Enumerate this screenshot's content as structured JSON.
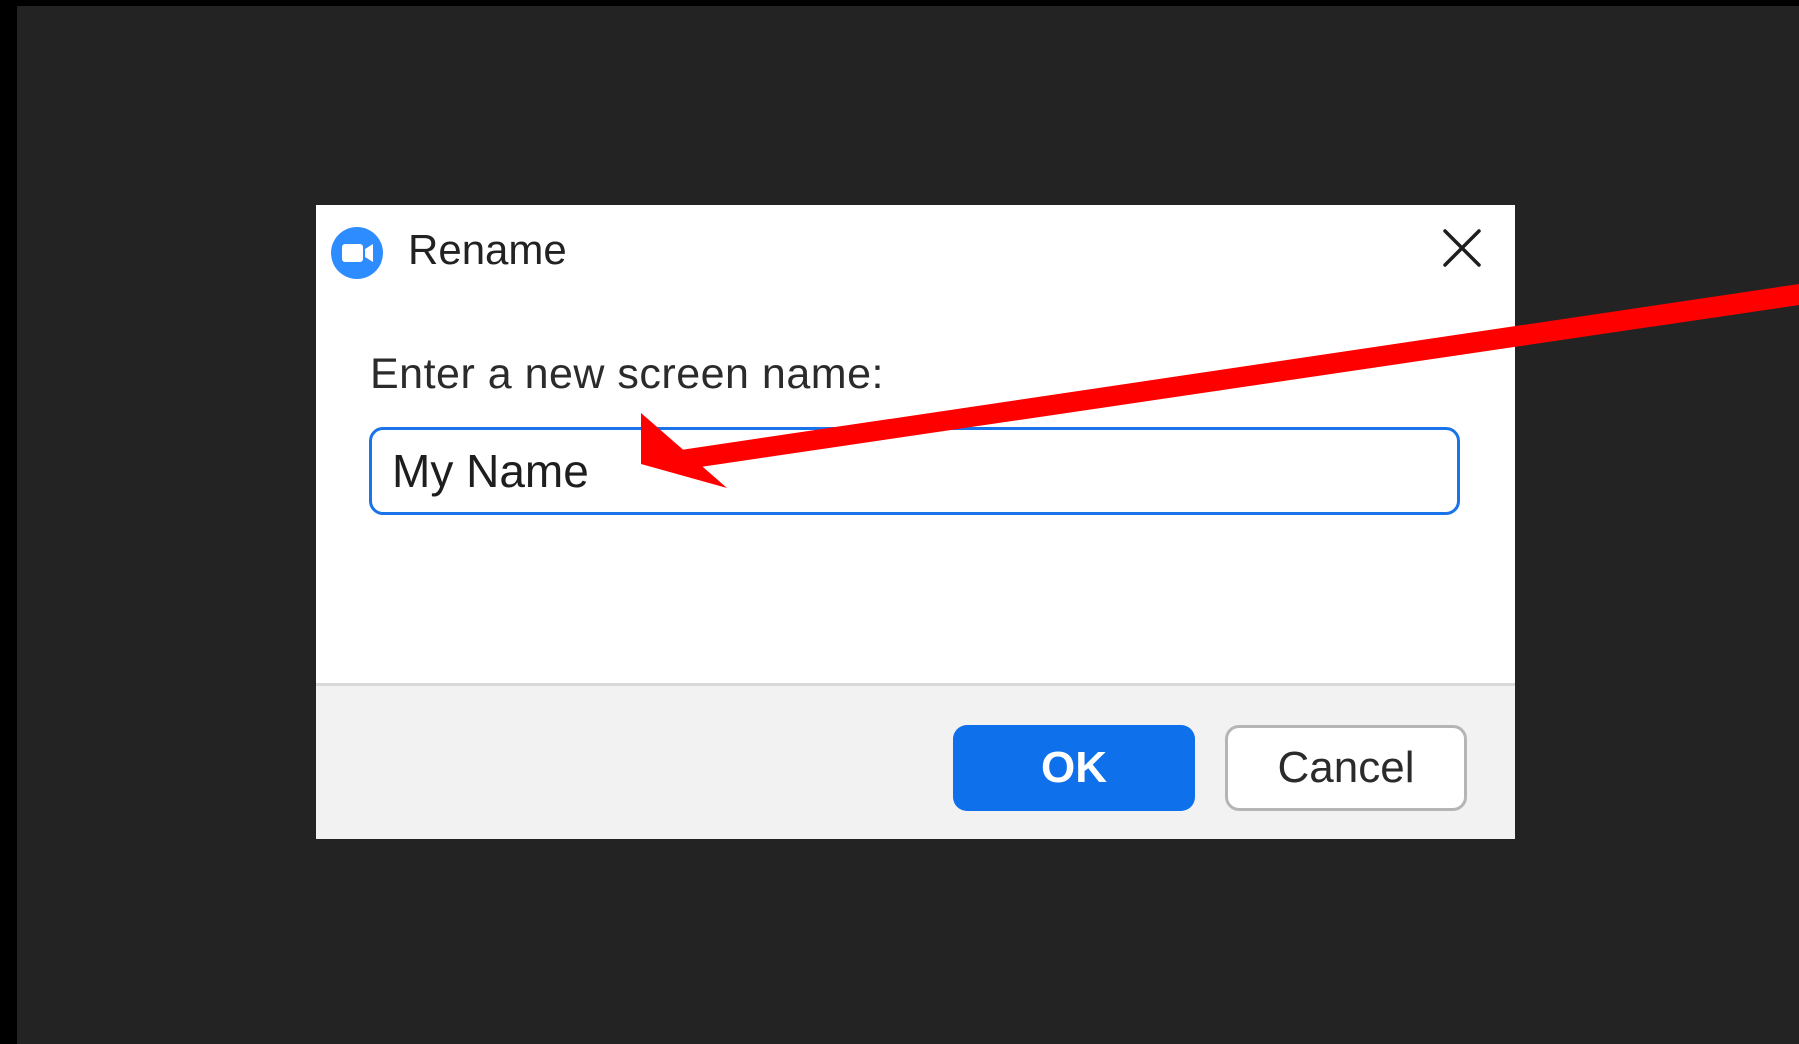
{
  "dialog": {
    "title": "Rename",
    "app_icon": "zoom-camera-icon",
    "close_icon": "close-icon",
    "prompt": "Enter a new screen name:",
    "name_value": "My Name",
    "ok_label": "OK",
    "cancel_label": "Cancel"
  },
  "colors": {
    "backdrop": "#232323",
    "accent": "#0e71eb",
    "input_border": "#1a73e8",
    "annotation_arrow": "#ff0000"
  },
  "annotation": {
    "type": "arrow",
    "points_to": "name-input"
  }
}
